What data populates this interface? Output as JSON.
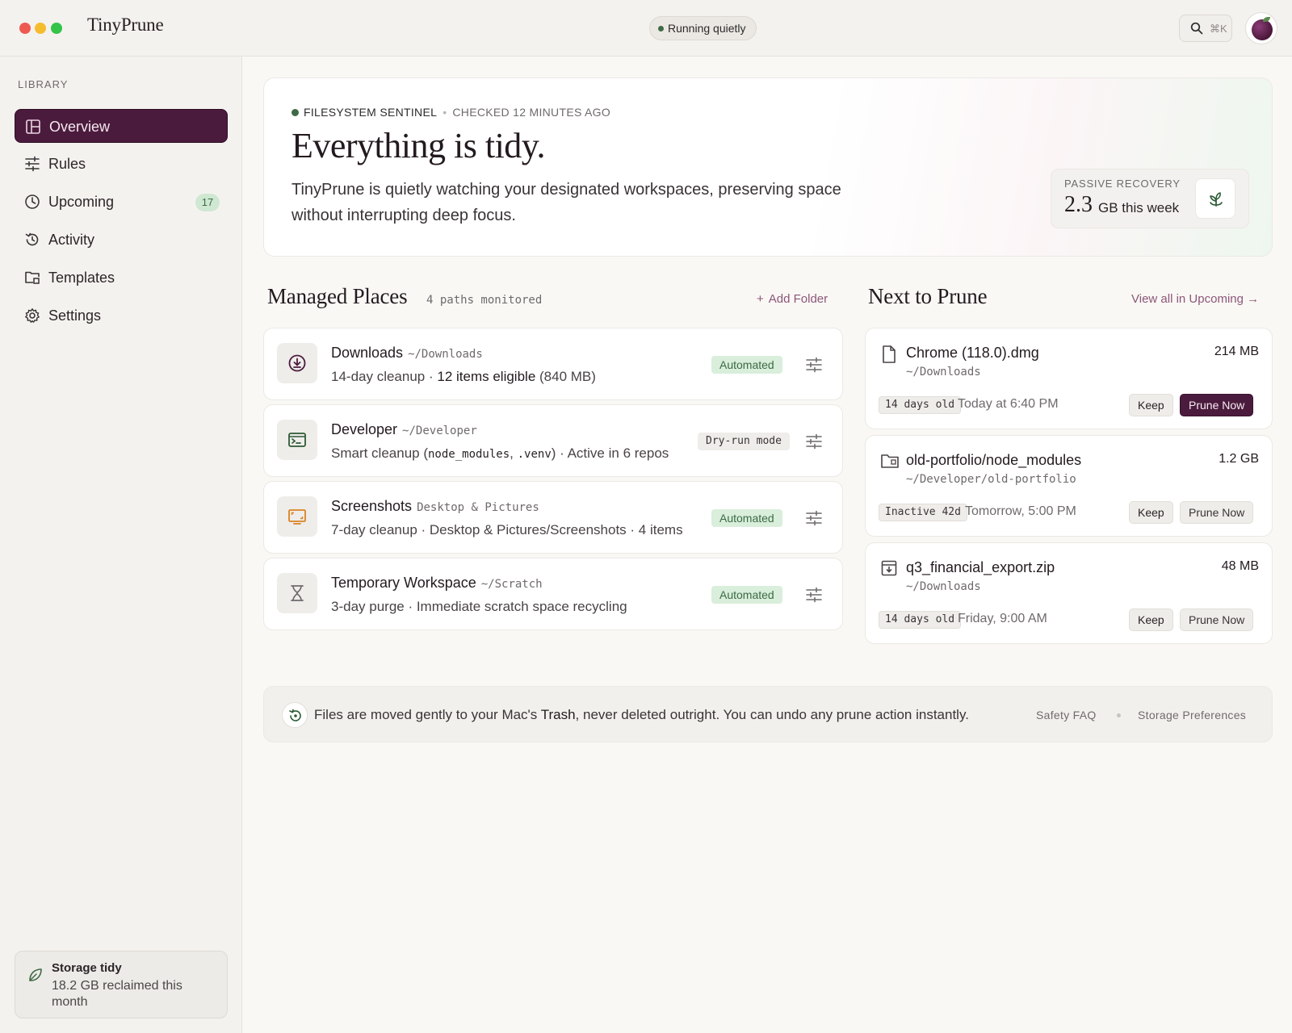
{
  "window": {
    "title": "TinyPrune"
  },
  "header": {
    "status": "Running quietly",
    "search_shortcut": "⌘K"
  },
  "sidebar": {
    "section_label": "LIBRARY",
    "items": [
      {
        "label": "Overview",
        "icon": "layout-icon",
        "active": true
      },
      {
        "label": "Rules",
        "icon": "sliders-icon"
      },
      {
        "label": "Upcoming",
        "icon": "clock-icon",
        "badge": "17"
      },
      {
        "label": "Activity",
        "icon": "history-icon"
      },
      {
        "label": "Templates",
        "icon": "folder-template-icon"
      },
      {
        "label": "Settings",
        "icon": "gear-icon"
      }
    ],
    "footer": {
      "title": "Storage tidy",
      "subtitle": "18.2 GB reclaimed this month"
    }
  },
  "hero": {
    "eyebrow": "FILESYSTEM SENTINEL",
    "checked": "CHECKED 12 MINUTES AGO",
    "title": "Everything is tidy.",
    "body": "TinyPrune is quietly watching your designated workspaces, preserving space without interrupting deep focus.",
    "recovery": {
      "label": "PASSIVE RECOVERY",
      "value": "2.3",
      "unit": "GB this week"
    }
  },
  "managed": {
    "title": "Managed Places",
    "meta": "4 paths monitored",
    "add_label": "Add Folder",
    "places": [
      {
        "name": "Downloads",
        "path": "~/Downloads",
        "desc_a": "14-day cleanup · ",
        "desc_b": "12 items eligible",
        "desc_c": " (840 MB)",
        "tag": "Automated"
      },
      {
        "name": "Developer",
        "path": "~/Developer",
        "desc_a": "Smart cleanup (",
        "code_a": "node_modules",
        "desc_b": ", ",
        "code_b": ".venv",
        "desc_c": ") · Active in 6 repos",
        "tag": "Dry-run mode"
      },
      {
        "name": "Screenshots",
        "path": "Desktop & Pictures",
        "desc": "7-day cleanup · Desktop & Pictures/Screenshots · 4 items",
        "tag": "Automated"
      },
      {
        "name": "Temporary Workspace",
        "path": "~/Scratch",
        "desc": "3-day purge · Immediate scratch space recycling",
        "tag": "Automated"
      }
    ]
  },
  "next": {
    "title": "Next to Prune",
    "view_all": "View all in Upcoming →",
    "items": [
      {
        "name": "Chrome (118.0).dmg",
        "path": "~/Downloads",
        "size": "214 MB",
        "age": "14 days old",
        "when": "Today at 6:40 PM",
        "keep": "Keep",
        "prune": "Prune Now"
      },
      {
        "name": "old-portfolio/node_modules",
        "path": "~/Developer/old-portfolio",
        "size": "1.2 GB",
        "age": "Inactive 42d",
        "when": "Tomorrow, 5:00 PM",
        "keep": "Keep",
        "prune": "Prune Now"
      },
      {
        "name": "q3_financial_export.zip",
        "path": "~/Downloads",
        "size": "48 MB",
        "age": "14 days old",
        "when": "Friday, 9:00 AM",
        "keep": "Keep",
        "prune": "Prune Now"
      }
    ]
  },
  "banner": {
    "text_a": "Files are moved gently to your Mac's ",
    "text_b": "Trash",
    "text_c": ", never deleted outright. You can undo any prune action instantly.",
    "link_faq": "Safety FAQ",
    "link_prefs": "Storage Preferences"
  },
  "colors": {
    "accent": "#4b1b3d",
    "success": "#3f6a45",
    "link": "#8d5678"
  }
}
